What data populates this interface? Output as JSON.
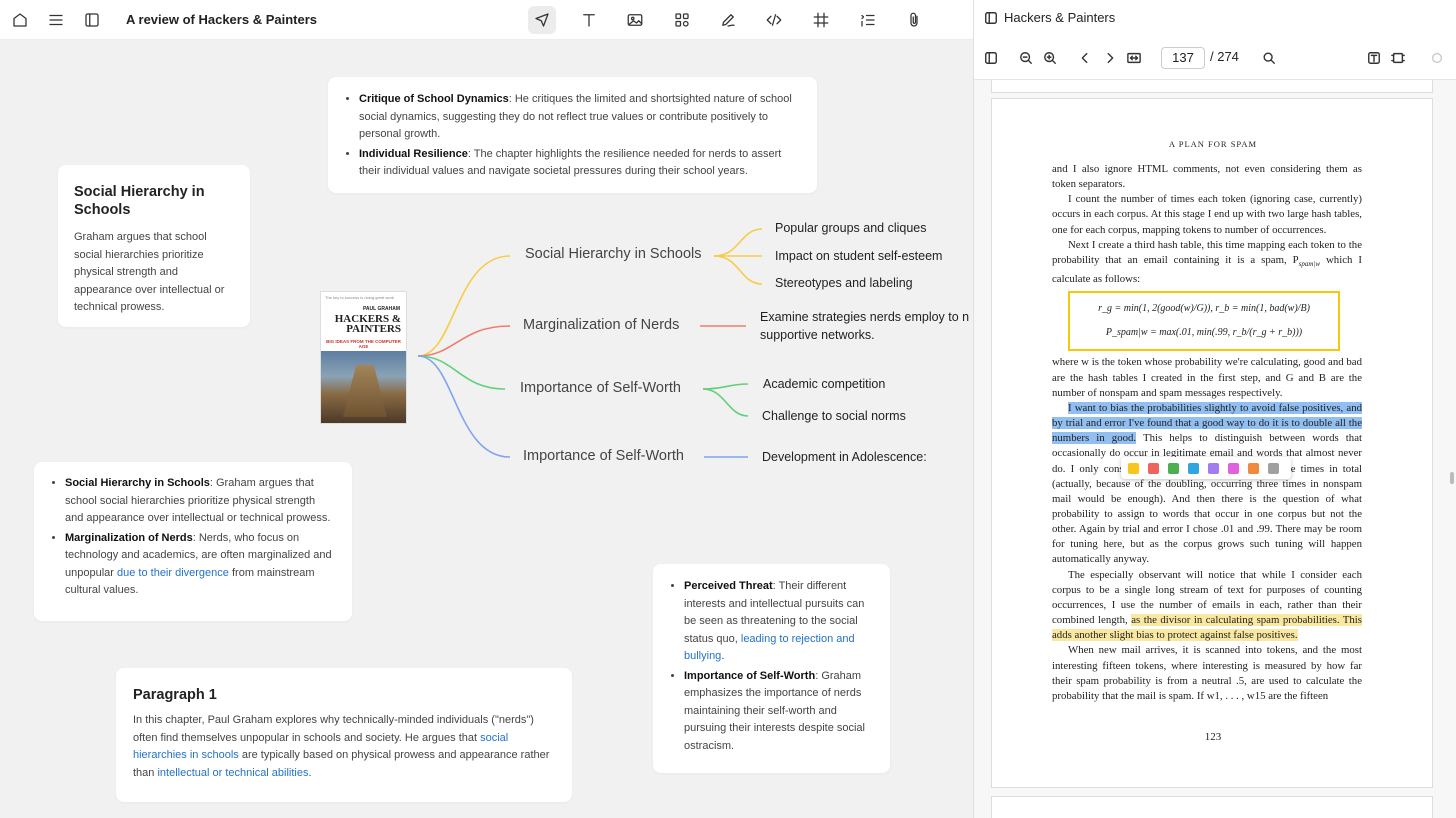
{
  "topbar": {
    "title": "A review of Hackers & Painters",
    "left_icons": [
      "home-icon",
      "menu-icon",
      "sidebar-icon"
    ],
    "tools": [
      "pointer-icon",
      "text-icon",
      "image-icon",
      "shapes-icon",
      "pen-icon",
      "code-icon",
      "frame-icon",
      "outline-icon",
      "attachment-icon"
    ]
  },
  "canvas": {
    "top_card": {
      "items": [
        {
          "term": "Critique of School Dynamics",
          "text": ": He critiques the limited and shortsighted nature of school social dynamics, suggesting they do not reflect true values or contribute positively to personal growth."
        },
        {
          "term": "Individual Resilience",
          "text": ": The chapter highlights the resilience needed for nerds to assert their individual values and navigate societal pressures during their school years."
        }
      ]
    },
    "hierarchy_card": {
      "title": "Social Hierarchy in Schools",
      "body": "Graham argues that school social hierarchies prioritize physical strength and appearance over intellectual or technical prowess."
    },
    "book": {
      "header": "The key to success is doing great work",
      "author": "PAUL GRAHAM",
      "title_line1": "HACKERS &",
      "title_line2": "PAINTERS",
      "subtitle": "BIG IDEAS FROM THE COMPUTER AGE"
    },
    "mindmap": {
      "branches": [
        {
          "label": "Social Hierarchy in Schools",
          "color": "#f5cd4a",
          "leaves": [
            "Popular groups and cliques",
            "Impact on student self-esteem",
            "Stereotypes and labeling"
          ]
        },
        {
          "label": "Marginalization of Nerds",
          "color": "#ee7d6c",
          "leaves": [
            "Examine strategies nerds employ to n",
            "supportive networks."
          ]
        },
        {
          "label": "Importance of Self-Worth",
          "color": "#5fd17a",
          "leaves": [
            "Academic competition",
            "Challenge to social norms"
          ]
        },
        {
          "label": "Importance of Self-Worth",
          "color": "#7fa4f2",
          "leaves": [
            "Development in Adolescence:"
          ]
        }
      ]
    },
    "left_card": {
      "items": [
        {
          "term": "Social Hierarchy in Schools",
          "text": ": Graham argues that school social hierarchies prioritize physical strength and appearance over intellectual or technical prowess."
        },
        {
          "term": "Marginalization of Nerds",
          "text_before": ": Nerds, who focus on technology and academics, are often marginalized and unpopular ",
          "link": "due to their divergence",
          "text_after": " from mainstream cultural values."
        }
      ]
    },
    "right_card": {
      "items": [
        {
          "term": "Perceived Threat",
          "text_before": ": Their different interests and intellectual pursuits can be seen as threatening to the social status quo, ",
          "link": "leading to rejection and bullying",
          "text_after": "."
        },
        {
          "term": "Importance of Self-Worth",
          "text": ": Graham emphasizes the importance of nerds maintaining their self-worth and pursuing their interests despite social ostracism."
        }
      ]
    },
    "paragraph_card": {
      "title": "Paragraph 1",
      "text1": "In this chapter, Paul Graham explores why technically-minded individuals (\"nerds\") often find themselves unpopular in schools and society. He argues that ",
      "link1": "social hierarchies in schools",
      "text2": " are typically based on physical prowess and appearance rather than ",
      "link2": "intellectual or technical abilities",
      "text3": "."
    }
  },
  "reader": {
    "title": "Hackers & Painters",
    "current_page": "137",
    "total_pages": "/ 274",
    "running_head": "A PLAN FOR SPAM",
    "page_number": "123",
    "p1": "and I also ignore HTML comments, not even considering them as token separators.",
    "p2": "I count the number of times each token (ignoring case, currently) occurs in each corpus. At this stage I end up with two large hash tables, one for each corpus, mapping tokens to number of occurrences.",
    "p3": "Next I create a third hash table, this time mapping each token to the probability that an email containing it is a spam, P",
    "p3_sub": "spam|w",
    "p3_end": " which I calculate as follows:",
    "formula1": "r_g = min(1, 2(good(w)/G)),   r_b = min(1, bad(w)/B)",
    "formula2": "P_spam|w = max(.01, min(.99, r_b/(r_g + r_b)))",
    "p4": "where w is the token whose probability we're calculating, good and bad are the hash tables I created in the first step, and G and B are the number of nonspam and spam messages respectively.",
    "p5_hl": "I want to bias the probabilities slightly to avoid false positives, and by trial and error I've found that a good way to do it is to double all the numbers in good.",
    "p5_rest": " This helps to distinguish between words that occasionally do occur in legitimate email and words that almost never do. I only consider words that occur more than five times in total (actually, because of the doubling, occurring three times in nonspam mail would be enough). And then there is the question of what probability to assign to words that occur in one corpus but not the other. Again by trial and error I chose .01 and .99. There may be room for tuning here, but as the corpus grows such tuning will happen automatically anyway.",
    "p6_start": "The especially observant will notice that while I consider each corpus to be a single long stream of text for purposes of counting occurrences, I use the number of emails in each, rather than their combined length, ",
    "p6_hl": "as the divisor in calculating spam probabilities. This adds another slight bias to protect against false positives.",
    "p7": "When new mail arrives, it is scanned into tokens, and the most interesting fifteen tokens, where interesting is measured by how far their spam probability is from a neutral .5, are used to calculate the probability that the mail is spam. If w1, . . . , w15 are the fifteen",
    "highlight_colors": [
      "#f7c51c",
      "#f0625e",
      "#4caf50",
      "#2ea6e0",
      "#a27cf0",
      "#e060e0",
      "#f08a3a",
      "#a0a0a0"
    ]
  }
}
